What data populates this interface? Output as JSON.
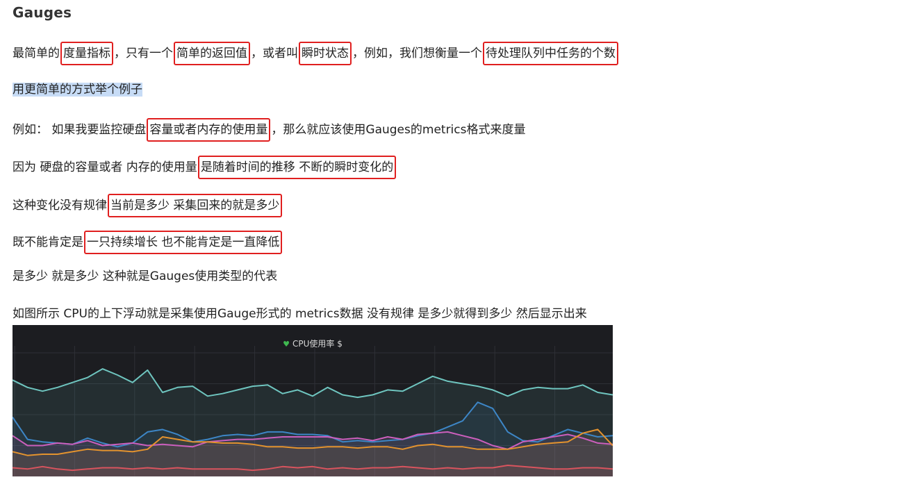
{
  "heading": "Gauges",
  "lines": [
    {
      "top": 60,
      "segments": [
        {
          "t": "最简单的"
        },
        {
          "t": "度量指标",
          "hl": true
        },
        {
          "t": "，只有一个"
        },
        {
          "t": "简单的返回值",
          "hl": true
        },
        {
          "t": "，或者叫"
        },
        {
          "t": "瞬时状态",
          "hl": true
        },
        {
          "t": "，例如，我们想衡量一个"
        },
        {
          "t": "待处理队列中任务的个数",
          "hl": true
        }
      ]
    },
    {
      "top": 117,
      "sel": true,
      "segments": [
        {
          "t": "用更简单的方式举个例子"
        }
      ]
    },
    {
      "top": 170,
      "segments": [
        {
          "t": "例如：  如果我要监控硬盘"
        },
        {
          "t": "容量或者内存的使用量",
          "hl": true
        },
        {
          "t": "，那么就应该使用Gauges的metrics格式来度量"
        }
      ]
    },
    {
      "top": 224,
      "segments": [
        {
          "t": "因为 硬盘的容量或者 内存的使用量"
        },
        {
          "t": "是随着时间的推移 不断的瞬时变化的",
          "hl": true
        }
      ]
    },
    {
      "top": 279,
      "segments": [
        {
          "t": "这种变化没有规律"
        },
        {
          "t": "当前是多少 采集回来的就是多少",
          "hl": true
        }
      ]
    },
    {
      "top": 332,
      "segments": [
        {
          "t": "既不能肯定是"
        },
        {
          "t": "一只持续增长 也不能肯定是一直降低",
          "hl": true
        }
      ]
    },
    {
      "top": 386,
      "segments": [
        {
          "t": "是多少 就是多少 这种就是Gauges使用类型的代表"
        }
      ]
    },
    {
      "top": 440,
      "segments": [
        {
          "t": "如图所示 CPU的上下浮动就是采集使用Gauge形式的 metrics数据 没有规律 是多少就得到多少 然后显示出来"
        }
      ]
    }
  ],
  "chart_data": {
    "type": "line",
    "title": "CPU使用率 $",
    "title_icon": "heart-icon",
    "background": "#1c1d21",
    "grid": true,
    "x": [
      0,
      1,
      2,
      3,
      4,
      5,
      6,
      7,
      8,
      9,
      10,
      11,
      12,
      13,
      14,
      15,
      16,
      17,
      18,
      19,
      20,
      21,
      22,
      23,
      24,
      25,
      26,
      27,
      28,
      29,
      30,
      31,
      32,
      33,
      34,
      35,
      36,
      37,
      38,
      39,
      40
    ],
    "ylim": [
      0,
      100
    ],
    "series": [
      {
        "color": "#6fc6c0",
        "values": [
          78,
          72,
          69,
          72,
          76,
          80,
          87,
          82,
          76,
          86,
          68,
          72,
          73,
          65,
          67,
          70,
          73,
          74,
          67,
          70,
          65,
          72,
          66,
          64,
          66,
          70,
          69,
          75,
          81,
          77,
          75,
          73,
          70,
          65,
          70,
          72,
          71,
          71,
          74,
          68,
          66
        ]
      },
      {
        "color": "#3d86c6",
        "values": [
          48,
          30,
          28,
          27,
          26,
          31,
          27,
          24,
          27,
          36,
          38,
          34,
          28,
          30,
          33,
          34,
          33,
          36,
          36,
          34,
          34,
          33,
          28,
          29,
          28,
          29,
          30,
          33,
          35,
          40,
          45,
          60,
          55,
          36,
          29,
          28,
          33,
          38,
          35,
          32,
          33
        ]
      },
      {
        "color": "#cc5fbd",
        "values": [
          33,
          25,
          25,
          27,
          26,
          29,
          25,
          26,
          27,
          25,
          26,
          25,
          24,
          28,
          29,
          30,
          30,
          31,
          32,
          32,
          32,
          32,
          30,
          31,
          29,
          32,
          30,
          34,
          35,
          36,
          33,
          30,
          25,
          22,
          28,
          30,
          32,
          34,
          31,
          27,
          26
        ]
      },
      {
        "color": "#e4932e",
        "values": [
          20,
          17,
          18,
          18,
          20,
          22,
          21,
          21,
          20,
          22,
          32,
          30,
          28,
          28,
          27,
          27,
          26,
          24,
          24,
          23,
          23,
          24,
          24,
          23,
          24,
          24,
          22,
          25,
          26,
          24,
          24,
          22,
          22,
          22,
          24,
          26,
          27,
          28,
          35,
          38,
          25
        ]
      },
      {
        "color": "#d9545e",
        "values": [
          7,
          6,
          8,
          6,
          5,
          6,
          7,
          7,
          6,
          7,
          6,
          7,
          6,
          6,
          6,
          6,
          5,
          6,
          8,
          7,
          8,
          6,
          7,
          6,
          7,
          7,
          8,
          7,
          6,
          7,
          6,
          7,
          7,
          9,
          8,
          7,
          6,
          6,
          7,
          7,
          6
        ]
      }
    ]
  }
}
